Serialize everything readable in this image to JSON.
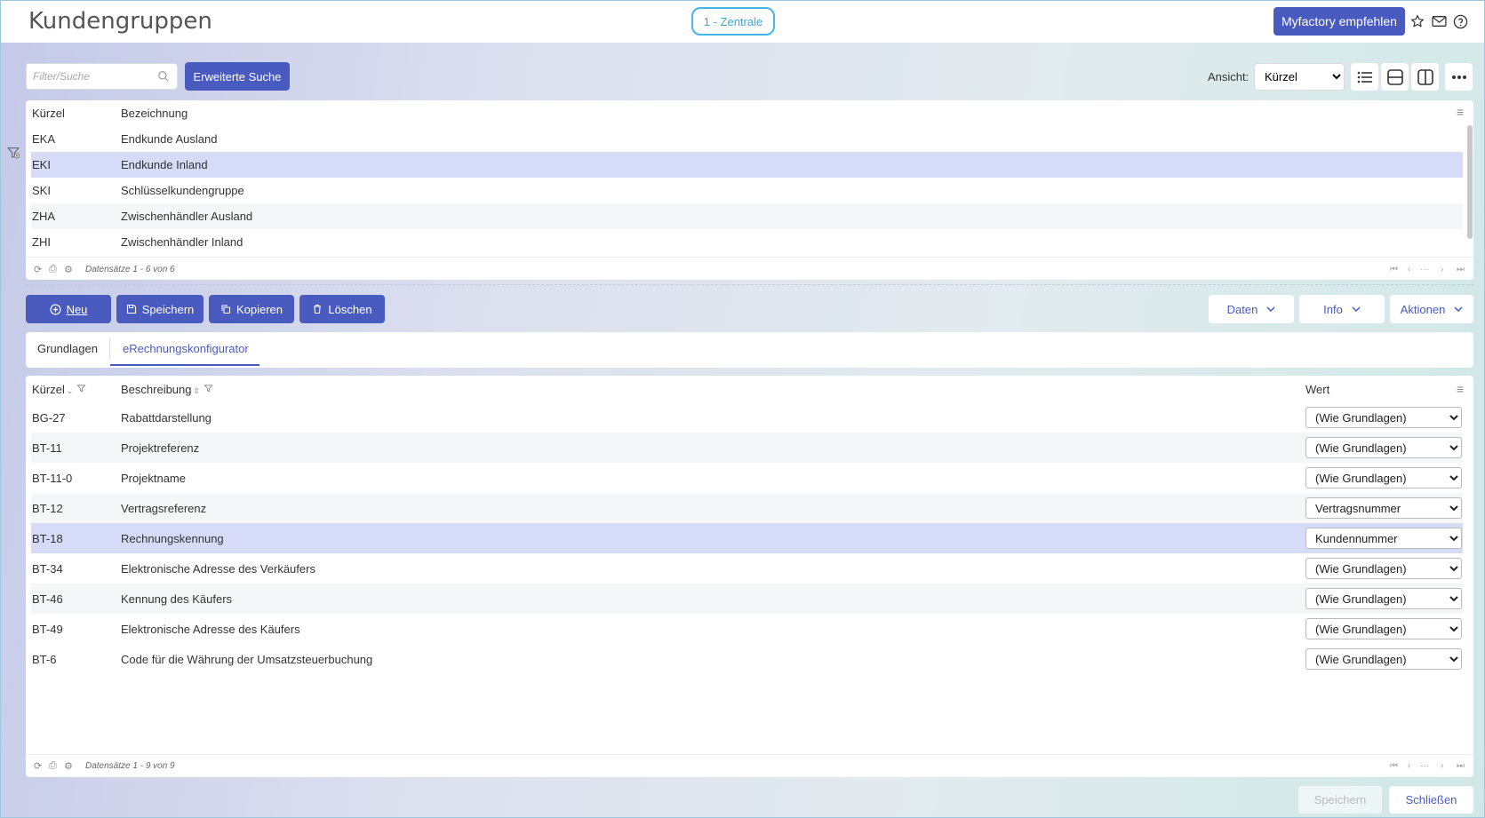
{
  "header": {
    "title": "Kundengruppen",
    "company": "1 - Zentrale",
    "recommend_label": "Myfactory empfehlen",
    "icons": [
      "star-icon",
      "mail-icon",
      "help-icon"
    ]
  },
  "toolbar": {
    "search_placeholder": "Filter/Suche",
    "advanced_search_label": "Erweiterte Suche",
    "view_label": "Ansicht:",
    "view_selected": "Kürzel"
  },
  "top_grid": {
    "headers": [
      "Kürzel",
      "Bezeichnung"
    ],
    "rows": [
      {
        "code": "EKA",
        "name": "Endkunde Ausland"
      },
      {
        "code": "EKI",
        "name": "Endkunde Inland"
      },
      {
        "code": "SKI",
        "name": "Schlüsselkundengruppe"
      },
      {
        "code": "ZHA",
        "name": "Zwischenhändler Ausland"
      },
      {
        "code": "ZHI",
        "name": "Zwischenhändler Inland"
      }
    ],
    "record_info": "Datensätze 1 - 6 von 6",
    "pager_ellipsis": "···"
  },
  "actions": {
    "new_label": "Neu",
    "save_label": "Speichern",
    "copy_label": "Kopieren",
    "delete_label": "Löschen",
    "data_label": "Daten",
    "info_label": "Info",
    "actions_label": "Aktionen"
  },
  "tabs": [
    {
      "label": "Grundlagen",
      "active": false
    },
    {
      "label": "eRechnungskonfigurator",
      "active": true
    }
  ],
  "detail_grid": {
    "headers": [
      "Kürzel",
      "Beschreibung",
      "Wert"
    ],
    "rows": [
      {
        "code": "BG-27",
        "desc": "Rabattdarstellung",
        "value": "(Wie Grundlagen)"
      },
      {
        "code": "BT-11",
        "desc": "Projektreferenz",
        "value": "(Wie Grundlagen)"
      },
      {
        "code": "BT-11-0",
        "desc": "Projektname",
        "value": "(Wie Grundlagen)"
      },
      {
        "code": "BT-12",
        "desc": "Vertragsreferenz",
        "value": "Vertragsnummer"
      },
      {
        "code": "BT-18",
        "desc": "Rechnungskennung",
        "value": "Kundennummer"
      },
      {
        "code": "BT-34",
        "desc": "Elektronische Adresse des Verkäufers",
        "value": "(Wie Grundlagen)"
      },
      {
        "code": "BT-46",
        "desc": "Kennung des Käufers",
        "value": "(Wie Grundlagen)"
      },
      {
        "code": "BT-49",
        "desc": "Elektronische Adresse des Käufers",
        "value": "(Wie Grundlagen)"
      },
      {
        "code": "BT-6",
        "desc": "Code für die Währung der Umsatzsteuerbuchung",
        "value": "(Wie Grundlagen)"
      }
    ],
    "record_info": "Datensätze 1 - 9 von 9",
    "pager_ellipsis": "···"
  },
  "bottom": {
    "save_label": "Speichern",
    "close_label": "Schließen"
  },
  "colors": {
    "accent": "#4a5bbf",
    "company_border": "#43b7e8",
    "selected_row": "#d6dcf7"
  }
}
